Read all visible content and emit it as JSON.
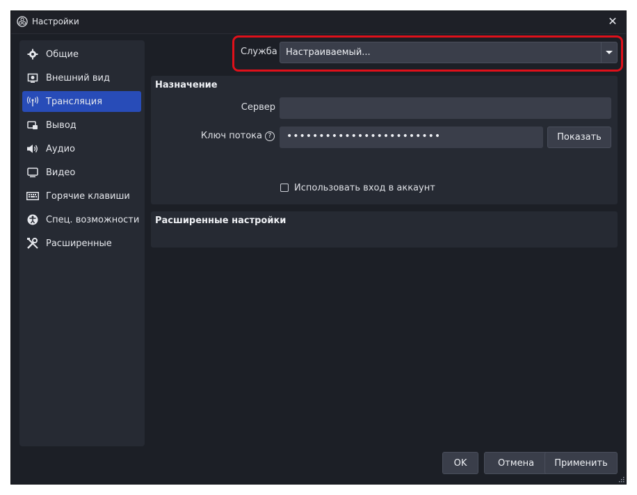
{
  "window": {
    "title": "Настройки"
  },
  "sidebar": {
    "items": [
      {
        "label": "Общие",
        "icon": "gear-icon"
      },
      {
        "label": "Внешний вид",
        "icon": "appearance-icon"
      },
      {
        "label": "Трансляция",
        "icon": "broadcast-icon",
        "active": true
      },
      {
        "label": "Вывод",
        "icon": "output-icon"
      },
      {
        "label": "Аудио",
        "icon": "speaker-icon"
      },
      {
        "label": "Видео",
        "icon": "monitor-icon"
      },
      {
        "label": "Горячие клавиши",
        "icon": "keyboard-icon"
      },
      {
        "label": "Спец. возможности",
        "icon": "accessibility-icon"
      },
      {
        "label": "Расширенные",
        "icon": "wrench-icon"
      }
    ]
  },
  "service": {
    "label": "Служба",
    "value": "Настраиваемый..."
  },
  "destination": {
    "title": "Назначение",
    "server_label": "Сервер",
    "server_value": "",
    "key_label": "Ключ потока",
    "key_value": "••••••••••••••••••••••••",
    "show_button": "Показать",
    "use_account_label": "Использовать вход в аккаунт",
    "use_account_checked": false
  },
  "advanced": {
    "title": "Расширенные настройки"
  },
  "footer": {
    "ok": "OK",
    "cancel": "Отмена",
    "apply": "Применить"
  },
  "colors": {
    "accent": "#284cb8",
    "highlight": "#e0101a",
    "background": "#1c1f26",
    "panel": "#262a33"
  }
}
